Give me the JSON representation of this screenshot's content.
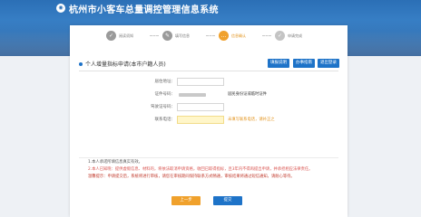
{
  "app": {
    "title": "杭州市小客车总量调控管理信息系统",
    "logo_icon": "hz-emblem-icon"
  },
  "steps": [
    {
      "label": "阅读须知",
      "state": "done",
      "icon": "check-icon"
    },
    {
      "label": "填写信息",
      "state": "done",
      "icon": "edit-icon"
    },
    {
      "label": "信息确认",
      "state": "current",
      "icon": "chat-icon"
    },
    {
      "label": "申请完成",
      "state": "todo",
      "icon": "check-icon"
    }
  ],
  "section": {
    "title": "个人增量指标申请(本市户籍人员)",
    "buttons": [
      "填报说明",
      "办事指南",
      "退出登录"
    ]
  },
  "form": {
    "fields": [
      {
        "label": "居住地址：",
        "value": "",
        "note": ""
      },
      {
        "label": "证件号码：",
        "value": "",
        "note": "",
        "blurred": true
      },
      {
        "label": "证件类型：",
        "value": "",
        "note": "居民身份证或临时证件"
      },
      {
        "label": "驾驶证号码：",
        "value": "",
        "note": ""
      },
      {
        "label": "联系电话：",
        "value": "",
        "note": "未填写联系电话，请补正之",
        "highlight": true
      }
    ]
  },
  "notes": [
    "1.本人承诺所填信息真实有效。",
    "2.本人已知晓：提供虚假信息、材料的，将依法取消申请资格，收回已取得指标，且3年内不得再提出申请，并承担相应法律责任。",
    "温馨提示：申请提交后，系统将进行审核，请您在审核期间保持联系方式畅通，审核结果将通过短信通知，请耐心等待。"
  ],
  "footer": {
    "prev": "上一步",
    "next": "提交"
  },
  "colors": {
    "accent": "#1e73c8",
    "orange": "#f0a12c",
    "header": "#2b6fb6"
  }
}
